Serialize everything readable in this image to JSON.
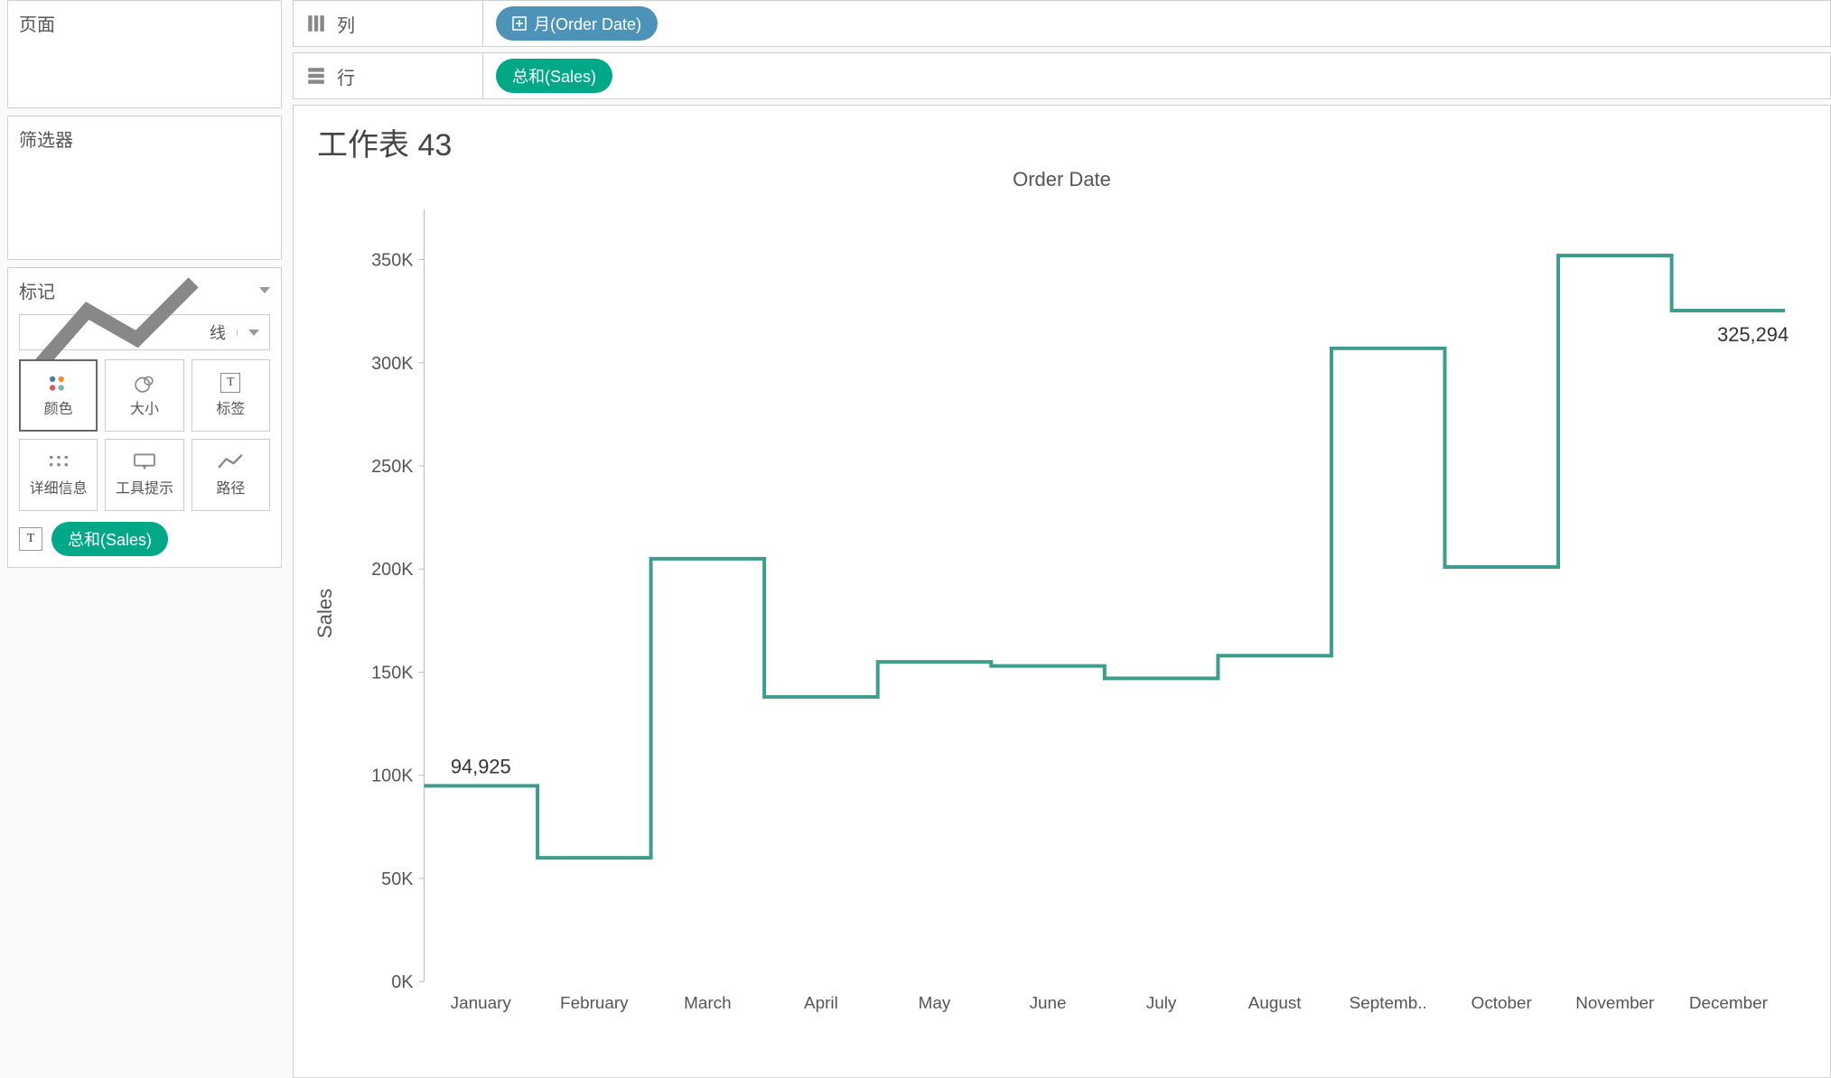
{
  "left": {
    "pages_label": "页面",
    "filters_label": "筛选器",
    "marks_label": "标记",
    "mark_type": "线",
    "cards": {
      "color": "颜色",
      "size": "大小",
      "label": "标签",
      "detail": "详细信息",
      "tooltip": "工具提示",
      "path": "路径"
    },
    "label_pill": "总和(Sales)"
  },
  "shelves": {
    "columns_label": "列",
    "columns_pill": "月(Order Date)",
    "rows_label": "行",
    "rows_pill": "总和(Sales)"
  },
  "viz": {
    "sheet_title": "工作表 43",
    "chart_title": "Order Date",
    "y_axis_label": "Sales"
  },
  "chart_data": {
    "type": "line",
    "style": "step",
    "title": "Order Date",
    "xlabel": "Order Date",
    "ylabel": "Sales",
    "ylim": [
      0,
      370000
    ],
    "y_ticks": [
      0,
      50000,
      100000,
      150000,
      200000,
      250000,
      300000,
      350000
    ],
    "y_tick_labels": [
      "0K",
      "50K",
      "100K",
      "150K",
      "200K",
      "250K",
      "300K",
      "350K"
    ],
    "categories": [
      "January",
      "February",
      "March",
      "April",
      "May",
      "June",
      "July",
      "August",
      "September",
      "October",
      "November",
      "December"
    ],
    "x_tick_labels": [
      "January",
      "February",
      "March",
      "April",
      "May",
      "June",
      "July",
      "August",
      "Septemb..",
      "October",
      "November",
      "December"
    ],
    "values": [
      94925,
      60000,
      205000,
      138000,
      155000,
      153000,
      147000,
      158000,
      307000,
      201000,
      352000,
      325294
    ],
    "annotations": [
      {
        "index": 0,
        "text": "94,925",
        "pos": "above"
      },
      {
        "index": 11,
        "text": "325,294",
        "pos": "right-below"
      }
    ],
    "line_color": "#3E9C8C"
  }
}
